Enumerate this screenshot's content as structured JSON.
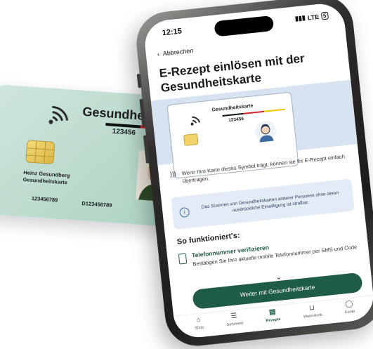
{
  "card": {
    "title": "Gesundheitskarte",
    "card_number": "123456",
    "holder_line1": "Heinz Gesundberg",
    "holder_line2": "Gesundheitskarte",
    "number_left": "123456789",
    "number_right": "D123456789",
    "flag_colors": [
      "#111111",
      "#d0242b",
      "#f2c400"
    ],
    "background": "#bddccd"
  },
  "status": {
    "time": "12:15",
    "network": "LTE",
    "battery": "5"
  },
  "nav": {
    "back_label": "Abbrechen"
  },
  "page": {
    "title": "E-Rezept einlösen mit der Gesundheitskarte",
    "illustration": {
      "card_title": "Gesundheitskarte",
      "card_number": "123456"
    },
    "nfc_info": "Wenn Ihre Karte dieses Symbol trägt, können sie Ihr E-Rezept einfach übertragen.",
    "hint": "Das Scannen von Gesundheitskarten anderer Personen ohne deren ausdrückliche Einwilligung ist strafbar.",
    "how_title": "So funktioniert's:",
    "step1_title": "Telefonnummer verifizieren",
    "step1_desc": "Bestätigen Sie Ihre aktuelle mobile Telefonnummer per SMS und Code",
    "cta": "Weiter mit Gesundheitskarte"
  },
  "tabs": [
    {
      "label": "Shop",
      "icon": "home-icon"
    },
    {
      "label": "Sortiment",
      "icon": "search-list-icon"
    },
    {
      "label": "Rezepte",
      "icon": "prescription-icon"
    },
    {
      "label": "Warenkorb",
      "icon": "cart-icon"
    },
    {
      "label": "Konto",
      "icon": "account-icon"
    }
  ],
  "colors": {
    "accent": "#1f5c45",
    "hint_bg": "#e3ecf6",
    "illustration_bg": "#d7e3f0"
  }
}
